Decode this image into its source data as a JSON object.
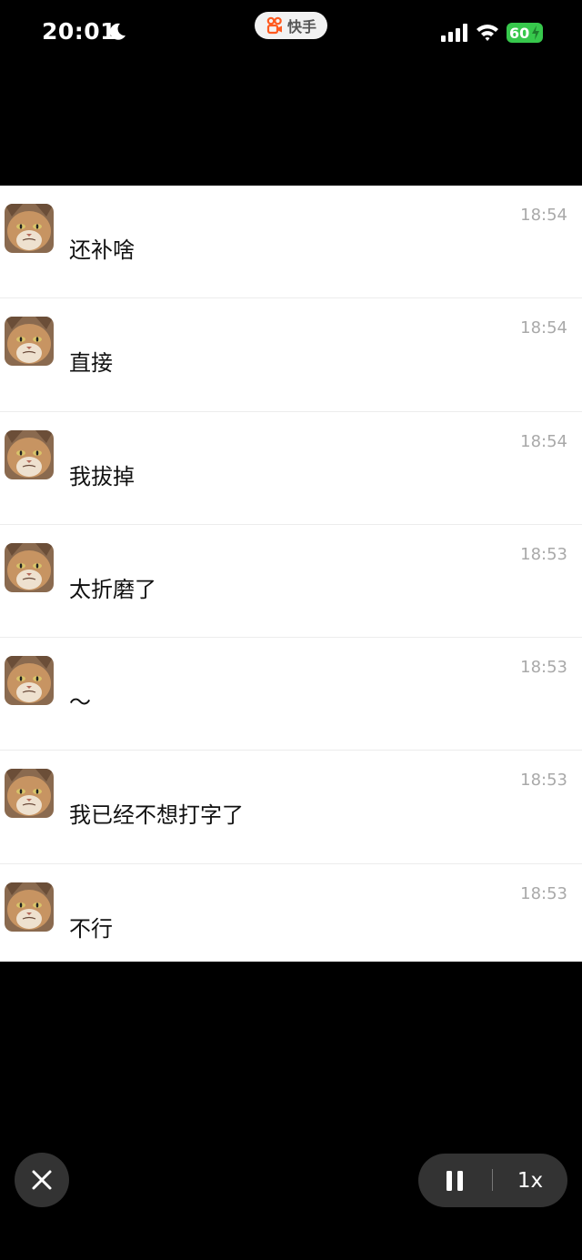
{
  "status_bar": {
    "time": "20:01",
    "app_label": "快手",
    "battery_level": "60",
    "battery_color": "#37c84c",
    "icons": [
      "moon-icon",
      "kuaishou-icon",
      "signal-icon",
      "wifi-icon",
      "battery-icon",
      "bolt-icon"
    ]
  },
  "messages": [
    {
      "text": "还补啥",
      "time": "18:54",
      "avatar": "cat-avatar"
    },
    {
      "text": "直接",
      "time": "18:54",
      "avatar": "cat-avatar"
    },
    {
      "text": "我拔掉",
      "time": "18:54",
      "avatar": "cat-avatar"
    },
    {
      "text": "太折磨了",
      "time": "18:53",
      "avatar": "cat-avatar"
    },
    {
      "text": "～",
      "time": "18:53",
      "avatar": "cat-avatar"
    },
    {
      "text": "我已经不想打字了",
      "time": "18:53",
      "avatar": "cat-avatar"
    },
    {
      "text": "不行",
      "time": "18:53",
      "avatar": "cat-avatar"
    }
  ],
  "controls": {
    "close_icon": "close-icon",
    "pause_icon": "pause-icon",
    "speed": "1x"
  }
}
